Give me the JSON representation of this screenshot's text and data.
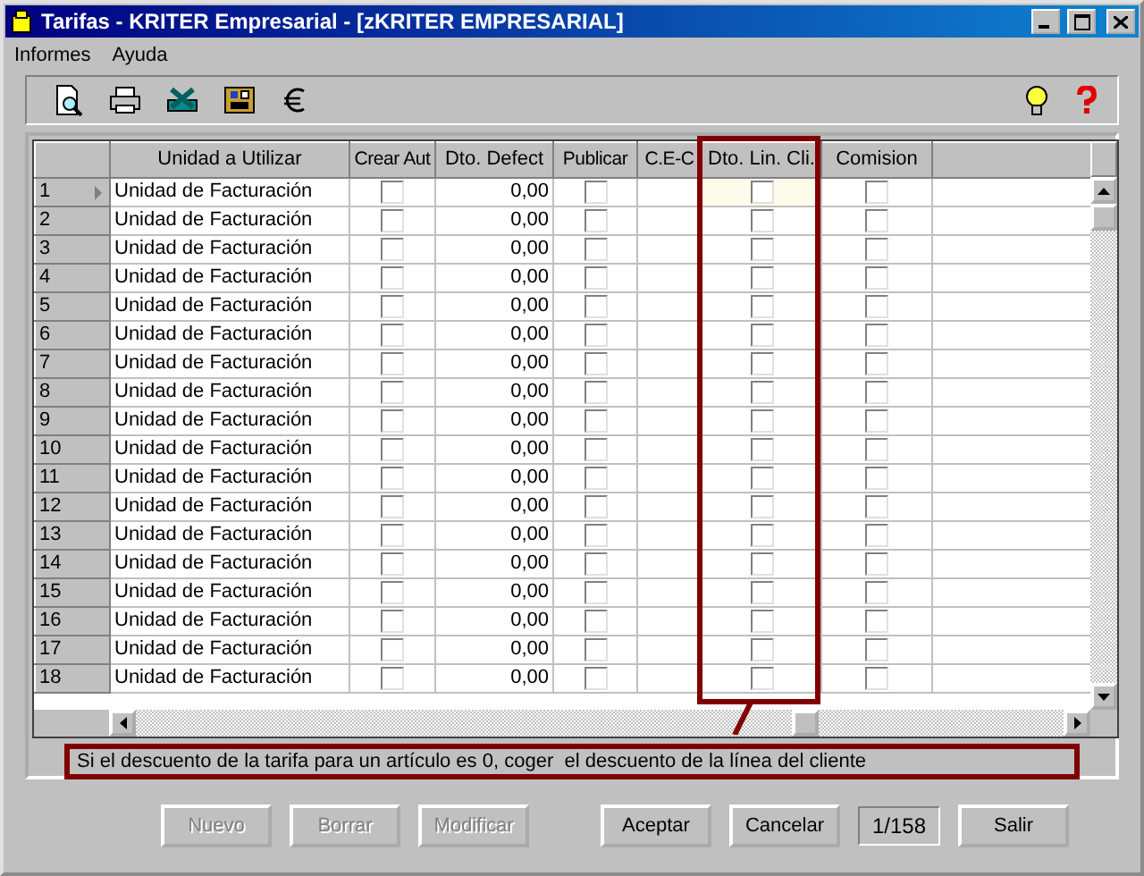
{
  "window": {
    "title": "Tarifas - KRITER Empresarial - [zKRITER EMPRESARIAL]"
  },
  "menu": [
    "Informes",
    "Ayuda"
  ],
  "table": {
    "columns": [
      {
        "label": "Unidad a Utilizar",
        "kind": "text"
      },
      {
        "label": "Crear Aut",
        "kind": "check"
      },
      {
        "label": "Dto. Defect",
        "kind": "number"
      },
      {
        "label": "Publicar",
        "kind": "check"
      },
      {
        "label": "C.E-C",
        "kind": "empty"
      },
      {
        "label": "Dto. Lin. Cli.",
        "kind": "check",
        "highlighted": true
      },
      {
        "label": "Comision",
        "kind": "check"
      }
    ],
    "rows": [
      {
        "number": "1",
        "selected": true,
        "cells": [
          "Unidad de Facturación",
          false,
          "0,00",
          false,
          false,
          false
        ]
      },
      {
        "number": "2",
        "selected": false,
        "cells": [
          "Unidad de Facturación",
          false,
          "0,00",
          false,
          false,
          false
        ]
      },
      {
        "number": "3",
        "selected": false,
        "cells": [
          "Unidad de Facturación",
          false,
          "0,00",
          false,
          false,
          false
        ]
      },
      {
        "number": "4",
        "selected": false,
        "cells": [
          "Unidad de Facturación",
          false,
          "0,00",
          false,
          false,
          false
        ]
      },
      {
        "number": "5",
        "selected": false,
        "cells": [
          "Unidad de Facturación",
          false,
          "0,00",
          false,
          false,
          false
        ]
      },
      {
        "number": "6",
        "selected": false,
        "cells": [
          "Unidad de Facturación",
          false,
          "0,00",
          false,
          false,
          false
        ]
      },
      {
        "number": "7",
        "selected": false,
        "cells": [
          "Unidad de Facturación",
          false,
          "0,00",
          false,
          false,
          false
        ]
      },
      {
        "number": "8",
        "selected": false,
        "cells": [
          "Unidad de Facturación",
          false,
          "0,00",
          false,
          false,
          false
        ]
      },
      {
        "number": "9",
        "selected": false,
        "cells": [
          "Unidad de Facturación",
          false,
          "0,00",
          false,
          false,
          false
        ]
      },
      {
        "number": "10",
        "selected": false,
        "cells": [
          "Unidad de Facturación",
          false,
          "0,00",
          false,
          false,
          false
        ]
      },
      {
        "number": "11",
        "selected": false,
        "cells": [
          "Unidad de Facturación",
          false,
          "0,00",
          false,
          false,
          false
        ]
      },
      {
        "number": "12",
        "selected": false,
        "cells": [
          "Unidad de Facturación",
          false,
          "0,00",
          false,
          false,
          false
        ]
      },
      {
        "number": "13",
        "selected": false,
        "cells": [
          "Unidad de Facturación",
          false,
          "0,00",
          false,
          false,
          false
        ]
      },
      {
        "number": "14",
        "selected": false,
        "cells": [
          "Unidad de Facturación",
          false,
          "0,00",
          false,
          false,
          false
        ]
      },
      {
        "number": "15",
        "selected": false,
        "cells": [
          "Unidad de Facturación",
          false,
          "0,00",
          false,
          false,
          false
        ]
      },
      {
        "number": "16",
        "selected": false,
        "cells": [
          "Unidad de Facturación",
          false,
          "0,00",
          false,
          false,
          false
        ]
      },
      {
        "number": "17",
        "selected": false,
        "cells": [
          "Unidad de Facturación",
          false,
          "0,00",
          false,
          false,
          false
        ]
      },
      {
        "number": "18",
        "selected": false,
        "cells": [
          "Unidad de Facturación",
          false,
          "0,00",
          false,
          false,
          false
        ]
      }
    ]
  },
  "hint": "Si el descuento de la tarifa para un artículo es 0, coger  el descuento de la línea del cliente",
  "footer": [
    {
      "kind": "button",
      "label": "Nuevo",
      "disabled": true
    },
    {
      "kind": "button",
      "label": "Borrar",
      "disabled": true
    },
    {
      "kind": "button",
      "label": "Modificar",
      "disabled": true
    },
    {
      "kind": "button",
      "label": "Aceptar",
      "disabled": false
    },
    {
      "kind": "button",
      "label": "Cancelar",
      "disabled": false
    },
    {
      "kind": "counter",
      "label": "1/158"
    },
    {
      "kind": "button",
      "label": "Salir",
      "disabled": false
    }
  ]
}
